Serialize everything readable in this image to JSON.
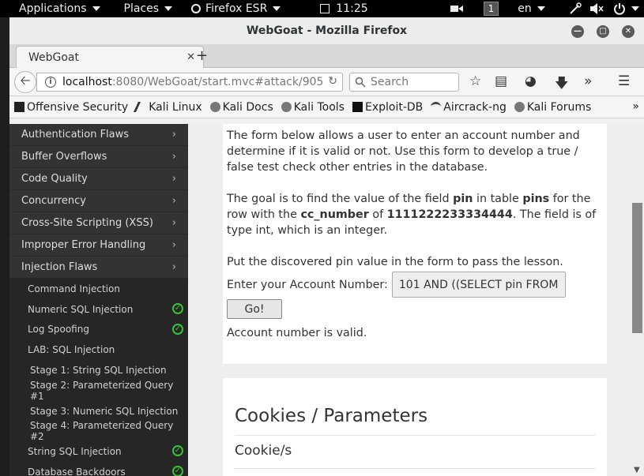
{
  "topbar": {
    "applications": "Applications",
    "places": "Places",
    "firefox": "Firefox ESR",
    "time": "11:25",
    "workspace": "1",
    "lang": "en"
  },
  "window": {
    "title": "WebGoat - Mozilla Firefox",
    "tab_title": "WebGoat",
    "url_host": "localhost",
    "url_path": ":8080/WebGoat/start.mvc#attack/905",
    "search_placeholder": "Search"
  },
  "bookmarks": [
    {
      "label": "Offensive Security",
      "icon": "offsec-icon"
    },
    {
      "label": "Kali Linux",
      "icon": "kali-icon"
    },
    {
      "label": "Kali Docs",
      "icon": "kali-docs-icon"
    },
    {
      "label": "Kali Tools",
      "icon": "kali-tools-icon"
    },
    {
      "label": "Exploit-DB",
      "icon": "exploit-db-icon"
    },
    {
      "label": "Aircrack-ng",
      "icon": "aircrack-icon"
    },
    {
      "label": "Kali Forums",
      "icon": "kali-forums-icon"
    }
  ],
  "sidebar": {
    "menus": [
      "Authentication Flaws",
      "Buffer Overflows",
      "Code Quality",
      "Concurrency",
      "Cross-Site Scripting (XSS)",
      "Improper Error Handling",
      "Injection Flaws"
    ],
    "subitems": [
      {
        "label": "Command Injection",
        "done": false
      },
      {
        "label": "Numeric SQL Injection",
        "done": true
      },
      {
        "label": "Log Spoofing",
        "done": true
      },
      {
        "label": "LAB: SQL Injection",
        "done": false
      },
      {
        "label": "Stage 1: String SQL Injection",
        "done": false
      },
      {
        "label": "Stage 2: Parameterized Query #1",
        "done": false
      },
      {
        "label": "Stage 3: Numeric SQL Injection",
        "done": false
      },
      {
        "label": "Stage 4: Parameterized Query #2",
        "done": false
      },
      {
        "label": "String SQL Injection",
        "done": true
      },
      {
        "label": "Database Backdoors",
        "done": true
      }
    ]
  },
  "lesson": {
    "p1": "The form below allows a user to enter an account number and determine if it is valid or not. Use this form to develop a true / false test check other entries in the database.",
    "p2_a": "The goal is to find the value of the field ",
    "p2_field": "pin",
    "p2_b": " in table ",
    "p2_table": "pins",
    "p2_c": " for the row with the ",
    "p2_col": "cc_number",
    "p2_d": " of ",
    "p2_num": "1111222233334444",
    "p2_e": ". The field is of type int, which is an integer.",
    "p3": "Put the discovered pin value in the form to pass the lesson.",
    "account_label": "Enter your Account Number:",
    "account_value": "101 AND ((SELECT pin FROM",
    "go_button": "Go!",
    "result": "Account number is valid."
  },
  "cookies": {
    "heading": "Cookies / Parameters",
    "subheading": "Cookie/s"
  }
}
